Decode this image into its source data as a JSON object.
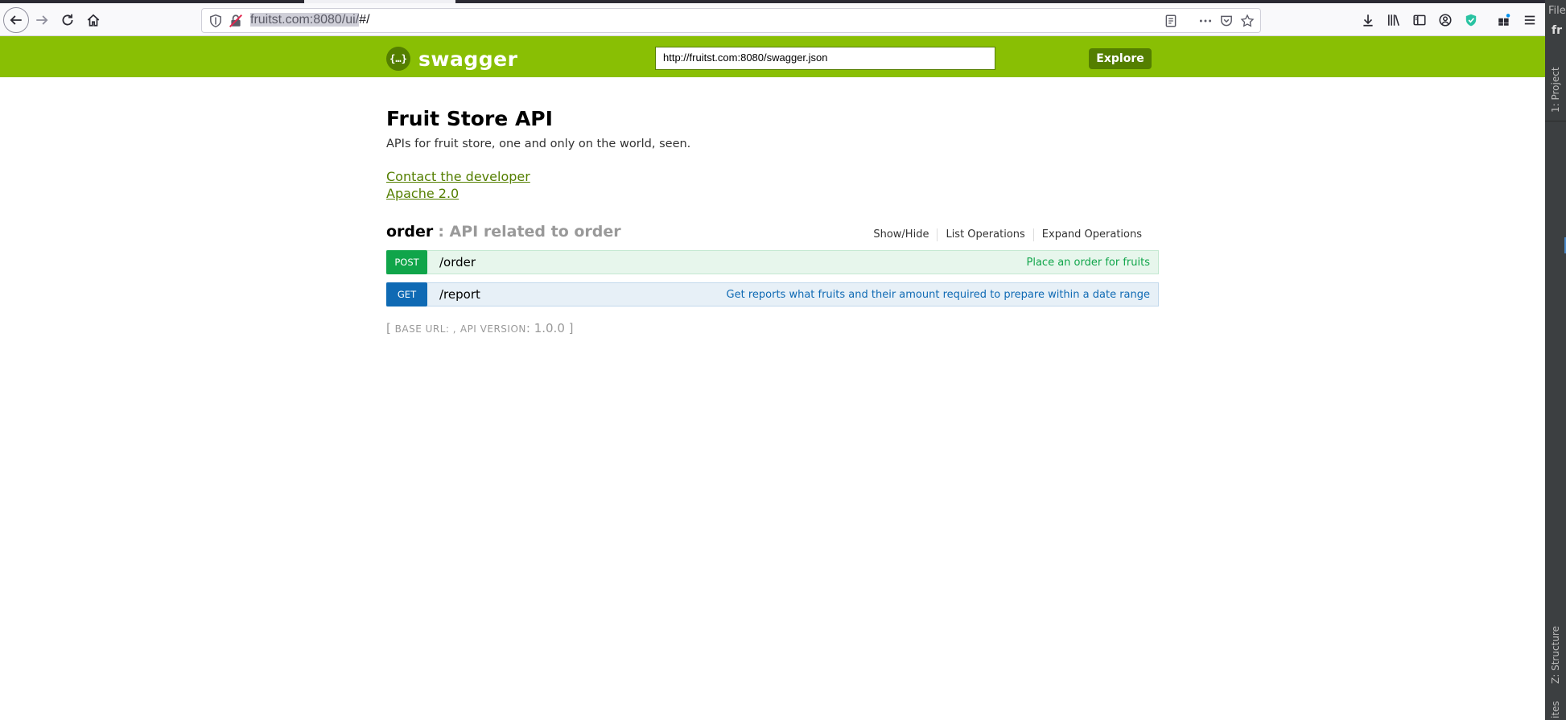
{
  "browser": {
    "url_selected": "fruitst.com:8080/ui/",
    "url_rest": "#/",
    "icons": [
      "back-icon",
      "forward-icon",
      "reload-icon",
      "home-icon",
      "shield-icon",
      "insecure-lock-icon",
      "reader-view-icon",
      "more-icon",
      "pocket-icon",
      "bookmark-star-icon",
      "download-icon",
      "library-icon",
      "sidebar-icon",
      "account-icon",
      "extension-shield-icon",
      "extensions-icon",
      "menu-icon"
    ]
  },
  "ide": {
    "top_label": "File",
    "top_label2": "fr",
    "project_tab": "1: Project",
    "structure_tab": "Z: Structure",
    "bottom_tab": "ites"
  },
  "swagger": {
    "logo_text": "swagger",
    "api_url": "http://fruitst.com:8080/swagger.json",
    "explore_label": "Explore"
  },
  "info": {
    "title": "Fruit Store API",
    "description": "APIs for fruit store, one and only on the world, seen.",
    "contact_link": "Contact the developer",
    "license_link": "Apache 2.0"
  },
  "resource": {
    "name": "order",
    "description": ": API related to order",
    "actions": [
      "Show/Hide",
      "List Operations",
      "Expand Operations"
    ],
    "operations": [
      {
        "method": "POST",
        "path": "/order",
        "summary": "Place an order for fruits"
      },
      {
        "method": "GET",
        "path": "/report",
        "summary": "Get reports what fruits and their amount required to prepare within a date range"
      }
    ]
  },
  "footer": {
    "open": "[",
    "base_url_label": "Base URL",
    "base_url_value": ": ,",
    "api_version_label": "API Version",
    "api_version_value": ": 1.0.0",
    "close": "]"
  },
  "colors": {
    "header_green": "#89bf04",
    "dark_green": "#547f00",
    "post_green": "#10a54a",
    "get_blue": "#0f6ab4"
  }
}
